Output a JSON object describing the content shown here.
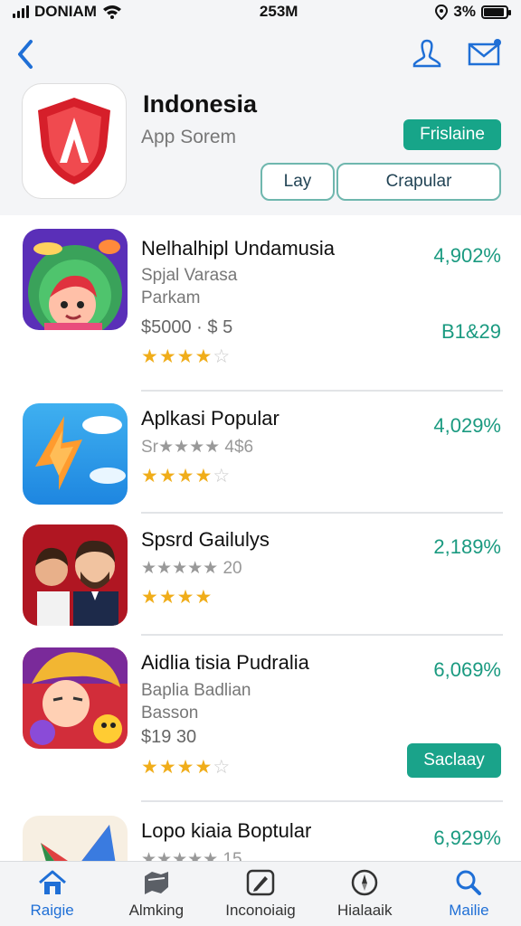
{
  "status_bar": {
    "carrier": "DONIAM",
    "time": "253M",
    "battery": "3%",
    "battery_level": 0.9
  },
  "header": {
    "app_title": "Indonesia",
    "app_subtitle": "App Sorem",
    "pill_button": "Frislaine",
    "segments": [
      "Lay",
      "Crapular"
    ]
  },
  "apps": [
    {
      "title": "Nelhalhipl Undamusia",
      "line1": "Spjal Varasa",
      "line2": "Parkam",
      "price": "$5000 · $ 5",
      "rating": 3.5,
      "pct": "4,902%",
      "side": "B1&29"
    },
    {
      "title": "Aplkasi Popular",
      "line1": "Sr★★★★ 4$6",
      "rating": 3.5,
      "pct": "4,029%"
    },
    {
      "title": "Spsrd Gailulys",
      "line1": "★★★★★ 20",
      "rating": 4,
      "pct": "2,189%"
    },
    {
      "title": "Aidlia tisia Pudralia",
      "line1": "Baplia Badlian",
      "line2": "Basson",
      "price": "$19 30",
      "rating": 4,
      "pct": "6,069%",
      "button": "Saclaay"
    },
    {
      "title": "Lopo kiaia Boptular",
      "line1": "★★★★★ 15",
      "pct": "6,929%"
    }
  ],
  "tabs": [
    {
      "label": "Raigie",
      "icon": "home-icon"
    },
    {
      "label": "Almking",
      "icon": "ranking-icon"
    },
    {
      "label": "Inconoiaig",
      "icon": "edit-icon"
    },
    {
      "label": "Hialaaik",
      "icon": "compass-icon"
    },
    {
      "label": "Mailie",
      "icon": "search-icon"
    }
  ],
  "colors": {
    "accent": "#17a589",
    "link_blue": "#1f6fd6",
    "star": "#f0ad1a"
  }
}
